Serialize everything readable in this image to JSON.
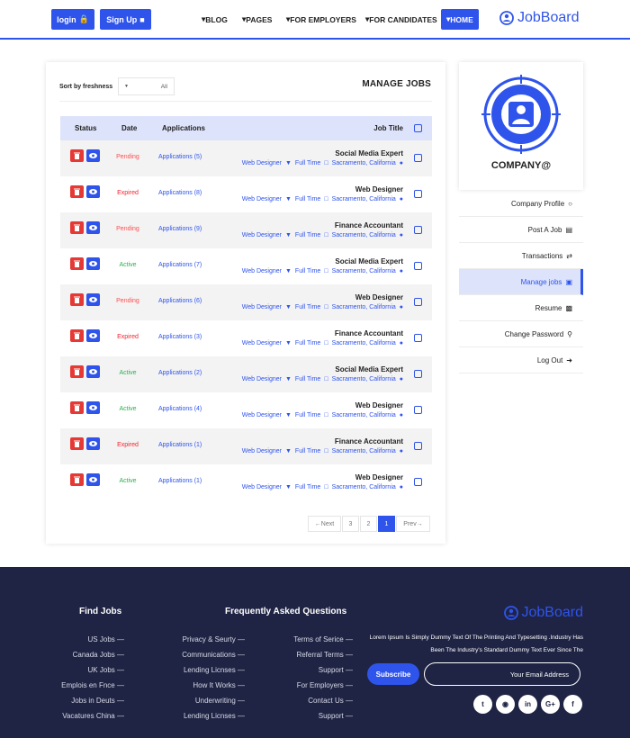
{
  "header": {
    "login_label": "login",
    "signup_label": "Sign Up",
    "nav": [
      "BLOG",
      "PAGES",
      "FOR EMPLOYERS",
      "FOR CANDIDATES",
      "HOME"
    ],
    "logo": "JobBoard"
  },
  "manage": {
    "sort_label": "Sort by freshness",
    "sort_value": "All",
    "title": "MANAGE JOBS",
    "columns": [
      "Status",
      "Date",
      "Applications",
      "Job Title"
    ],
    "jobs": [
      {
        "status": "Pending",
        "apps": "Applications (5)",
        "title": "Social Media Expert",
        "type": "Web Designer",
        "time": "Full Time",
        "loc": "Sacramento, California"
      },
      {
        "status": "Expired",
        "apps": "Applications (8)",
        "title": "Web Designer",
        "type": "Web Designer",
        "time": "Full Time",
        "loc": "Sacramento, California"
      },
      {
        "status": "Pending",
        "apps": "Applications (9)",
        "title": "Finance Accountant",
        "type": "Web Designer",
        "time": "Full Time",
        "loc": "Sacramento, California"
      },
      {
        "status": "Active",
        "apps": "Applications (7)",
        "title": "Social Media Expert",
        "type": "Web Designer",
        "time": "Full Time",
        "loc": "Sacramento, California"
      },
      {
        "status": "Pending",
        "apps": "Applications (6)",
        "title": "Web Designer",
        "type": "Web Designer",
        "time": "Full Time",
        "loc": "Sacramento, California"
      },
      {
        "status": "Expired",
        "apps": "Applications (3)",
        "title": "Finance Accountant",
        "type": "Web Designer",
        "time": "Full Time",
        "loc": "Sacramento, California"
      },
      {
        "status": "Active",
        "apps": "Applications (2)",
        "title": "Social Media Expert",
        "type": "Web Designer",
        "time": "Full Time",
        "loc": "Sacramento, California"
      },
      {
        "status": "Active",
        "apps": "Applications (4)",
        "title": "Web Designer",
        "type": "Web Designer",
        "time": "Full Time",
        "loc": "Sacramento, California"
      },
      {
        "status": "Expired",
        "apps": "Applications (1)",
        "title": "Finance Accountant",
        "type": "Web Designer",
        "time": "Full Time",
        "loc": "Sacramento, California"
      },
      {
        "status": "Active",
        "apps": "Applications (1)",
        "title": "Web Designer",
        "type": "Web Designer",
        "time": "Full Time",
        "loc": "Sacramento, California"
      }
    ],
    "pagination": {
      "next": "Next",
      "pages": [
        "3",
        "2",
        "1"
      ],
      "active": "1",
      "prev": "Prev"
    }
  },
  "company": {
    "name": "COMPANY@",
    "menu": [
      {
        "label": "Company Profile",
        "icon": "user-icon"
      },
      {
        "label": "Post A Job",
        "icon": "document-icon"
      },
      {
        "label": "Transactions",
        "icon": "shuffle-icon"
      },
      {
        "label": "Manage jobs",
        "icon": "briefcase-icon",
        "active": true
      },
      {
        "label": "Resume",
        "icon": "id-card-icon"
      },
      {
        "label": "Change Password",
        "icon": "key-icon"
      },
      {
        "label": "Log Out",
        "icon": "logout-icon"
      }
    ]
  },
  "footer": {
    "find_jobs_title": "Find Jobs",
    "find_jobs": [
      "US Jobs",
      "Canada Jobs",
      "UK Jobs",
      "Emplois en Fnce",
      "Jobs in Deuts",
      "Vacatures China"
    ],
    "faq_title": "Frequently Asked Questions",
    "faq_col1": [
      "Privacy & Seurty",
      "Communications",
      "Lending Licnses",
      "How It Works",
      "Underwriting",
      "Lending Licnses"
    ],
    "faq_col2": [
      "Terms of Serice",
      "Referral Terms",
      "Support",
      "For Employers",
      "Contact Us",
      "Support"
    ],
    "logo": "JobBoard",
    "description": "Lorem Ipsum Is Simply Dummy Text Of The Printing And Typesetting .Industry Has Been The Industry's Standard Dummy Text Ever Since The",
    "subscribe_label": "Subscribe",
    "email_placeholder": "Your Email Address",
    "social": [
      "twitter-icon",
      "instagram-icon",
      "linkedin-icon",
      "google-plus-icon",
      "facebook-icon"
    ]
  },
  "colors": {
    "accent": "#2f54eb",
    "footer_bg": "#1f2444",
    "active_status": "#28b04a",
    "expired_status": "#f5222d"
  }
}
